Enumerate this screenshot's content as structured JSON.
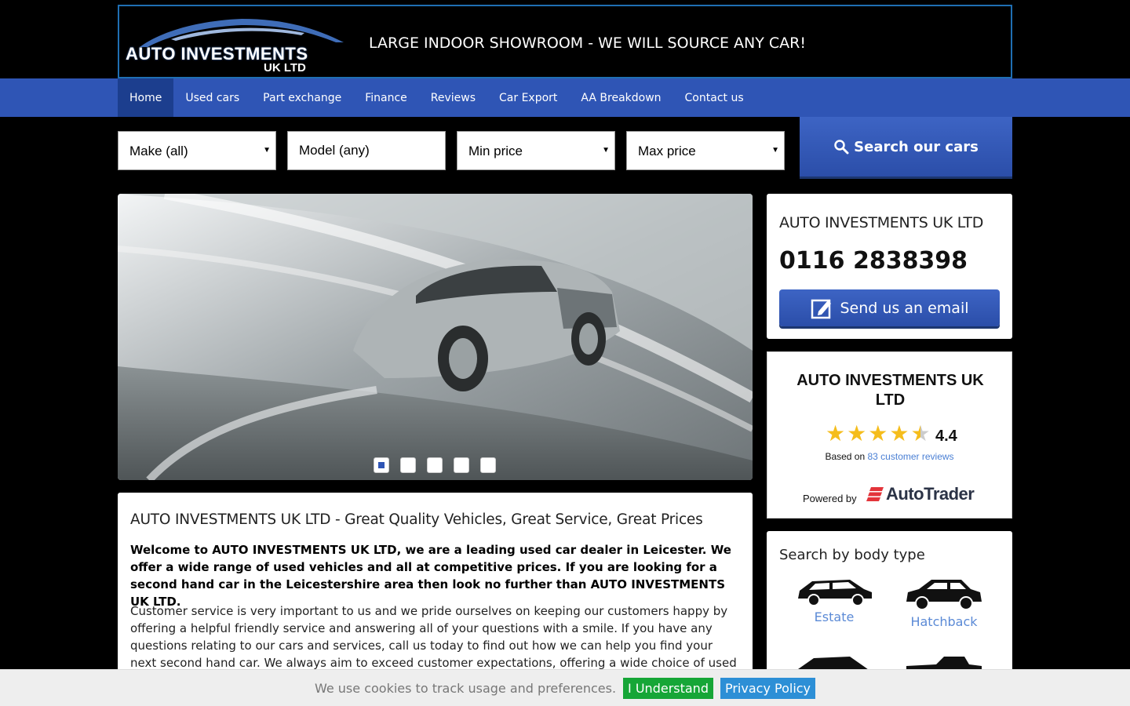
{
  "header": {
    "logo_text": "AUTO INVESTMENTS",
    "logo_sub": "UK LTD",
    "tagline": "LARGE INDOOR SHOWROOM - WE WILL SOURCE ANY  CAR!"
  },
  "nav": {
    "items": [
      "Home",
      "Used cars",
      "Part exchange",
      "Finance",
      "Reviews",
      "Car Export",
      "AA Breakdown",
      "Contact us"
    ],
    "active": "Home"
  },
  "search": {
    "make": "Make (all)",
    "model": "Model (any)",
    "min_price": "Min price",
    "max_price": "Max price",
    "button": "Search our cars"
  },
  "slider": {
    "slide_count": 5,
    "active_slide": 1
  },
  "contact": {
    "name": "AUTO INVESTMENTS UK LTD",
    "phone": "0116 2838398",
    "email_button": "Send us an email"
  },
  "reviews_widget": {
    "title": "AUTO INVESTMENTS UK LTD",
    "rating": "4.4",
    "stars": 4.4,
    "based_prefix": "Based on",
    "reviews_link": "83 customer reviews",
    "powered_by": "Powered by",
    "provider": "AutoTrader"
  },
  "body_types": {
    "title": "Search by body type",
    "items": [
      "Estate",
      "Hatchback"
    ]
  },
  "content": {
    "heading": "AUTO INVESTMENTS UK LTD - Great Quality Vehicles, Great Service, Great  Prices",
    "lead": "Welcome to AUTO INVESTMENTS UK LTD, we are a leading used car dealer in Leicester. We offer a wide range of used vehicles and all at competitive prices. If you are looking for a second hand car in the Leicestershire area then look no further than AUTO INVESTMENTS UK LTD.",
    "paragraph": "Customer service is very important to us and we pride ourselves on keeping our customers happy by offering a helpful friendly service and answering all of your questions with a smile. If you have any questions relating to our cars and services, call us today to find out how we can help you find your next second hand car. We always aim to exceed customer expectations, offering a wide choice of used cars"
  },
  "cookie_bar": {
    "message": "We use cookies to track usage and preferences.",
    "accept": "I Understand",
    "policy": "Privacy Policy"
  },
  "colors": {
    "nav_blue": "#2f55b5",
    "nav_active": "#1c3e8e",
    "star_gold": "#f5bd1c",
    "link_blue": "#4a7fd4",
    "accept_green": "#16a637",
    "policy_blue": "#2d8fd6"
  }
}
